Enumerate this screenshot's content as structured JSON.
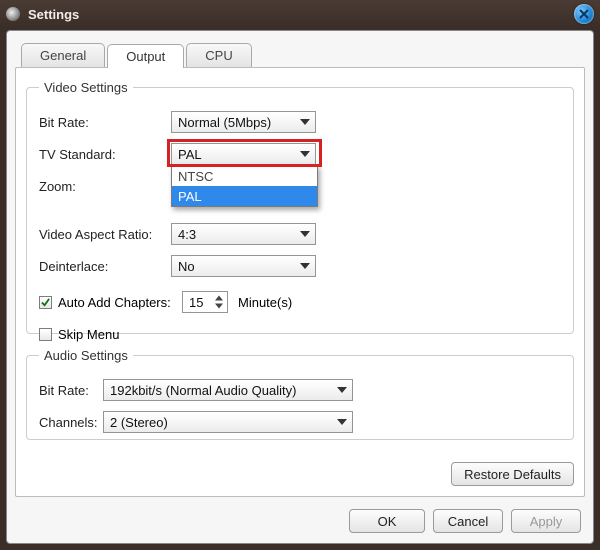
{
  "window": {
    "title": "Settings"
  },
  "tabs": {
    "general": "General",
    "output": "Output",
    "cpu": "CPU",
    "active": "output"
  },
  "video": {
    "legend": "Video Settings",
    "bitRate": {
      "label": "Bit Rate:",
      "value": "Normal (5Mbps)"
    },
    "tvStandard": {
      "label": "TV Standard:",
      "value": "PAL",
      "options": [
        "NTSC",
        "PAL"
      ],
      "highlighted_option": "PAL",
      "open": true
    },
    "zoom": {
      "label": "Zoom:"
    },
    "aspect": {
      "label": "Video Aspect Ratio:",
      "value": "4:3"
    },
    "deinterlace": {
      "label": "Deinterlace:",
      "value": "No"
    },
    "autoChapters": {
      "checked": true,
      "label": "Auto Add Chapters:",
      "value": "15",
      "unit": "Minute(s)"
    },
    "skipMenu": {
      "checked": false,
      "label": "Skip Menu"
    }
  },
  "audio": {
    "legend": "Audio Settings",
    "bitRate": {
      "label": "Bit Rate:",
      "value": "192kbit/s (Normal Audio Quality)"
    },
    "channels": {
      "label": "Channels:",
      "value": "2 (Stereo)"
    }
  },
  "buttons": {
    "restore": "Restore Defaults",
    "ok": "OK",
    "cancel": "Cancel",
    "apply": "Apply"
  }
}
